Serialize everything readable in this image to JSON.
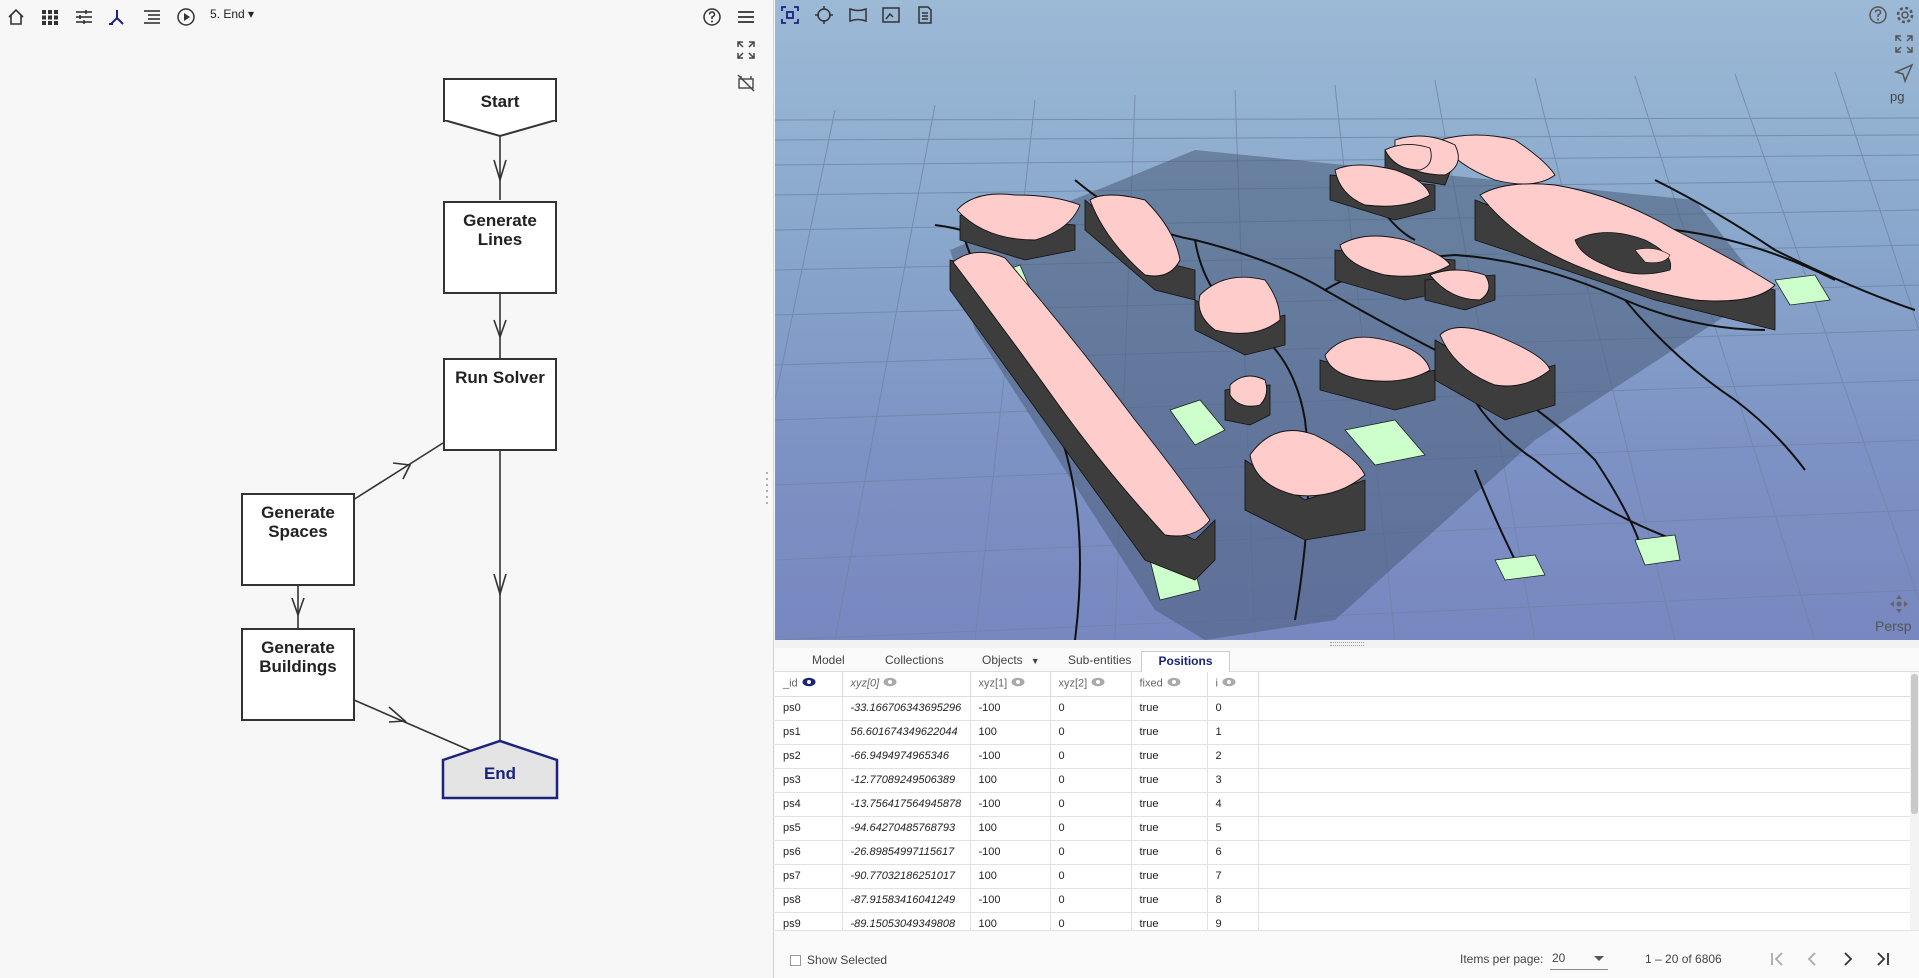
{
  "toolbar": {
    "flow_name": "5. End",
    "icons": [
      "home-icon",
      "grid-icon",
      "sliders-icon",
      "node-icon",
      "list-icon",
      "play-icon",
      "help-icon",
      "menu-icon"
    ]
  },
  "flowchart": {
    "nodes": {
      "start": "Start",
      "generate_lines": "Generate Lines",
      "run_solver": "Run Solver",
      "generate_spaces": "Generate Spaces",
      "generate_buildings": "Generate Buildings",
      "end": "End"
    }
  },
  "viewer": {
    "pg_label": "pg",
    "persp_label": "Persp",
    "colors": {
      "building_top": "#ffcccc",
      "park": "#ccffcc",
      "road": "#1a1a1a"
    }
  },
  "tabs": [
    "Model",
    "Collections",
    "Objects",
    "Sub-entities",
    "Positions"
  ],
  "active_tab": "Positions",
  "table": {
    "headers": [
      "_id",
      "xyz[0]",
      "xyz[1]",
      "xyz[2]",
      "fixed",
      "i"
    ],
    "rows": [
      [
        "ps0",
        "-33.166706343695296",
        "-100",
        "0",
        "true",
        "0"
      ],
      [
        "ps1",
        "56.601674349622044",
        "100",
        "0",
        "true",
        "1"
      ],
      [
        "ps2",
        "-66.9494974965346",
        "-100",
        "0",
        "true",
        "2"
      ],
      [
        "ps3",
        "-12.77089249506389",
        "100",
        "0",
        "true",
        "3"
      ],
      [
        "ps4",
        "-13.756417564945878",
        "-100",
        "0",
        "true",
        "4"
      ],
      [
        "ps5",
        "-94.64270485768793",
        "100",
        "0",
        "true",
        "5"
      ],
      [
        "ps6",
        "-26.89854997115617",
        "-100",
        "0",
        "true",
        "6"
      ],
      [
        "ps7",
        "-90.77032186251017",
        "100",
        "0",
        "true",
        "7"
      ],
      [
        "ps8",
        "-87.91583416041249",
        "-100",
        "0",
        "true",
        "8"
      ],
      [
        "ps9",
        "-89.15053049349808",
        "100",
        "0",
        "true",
        "9"
      ]
    ]
  },
  "footer": {
    "show_selected": "Show Selected",
    "items_per_page_label": "Items per page:",
    "items_per_page": "20",
    "range": "1 – 20 of 6806"
  }
}
